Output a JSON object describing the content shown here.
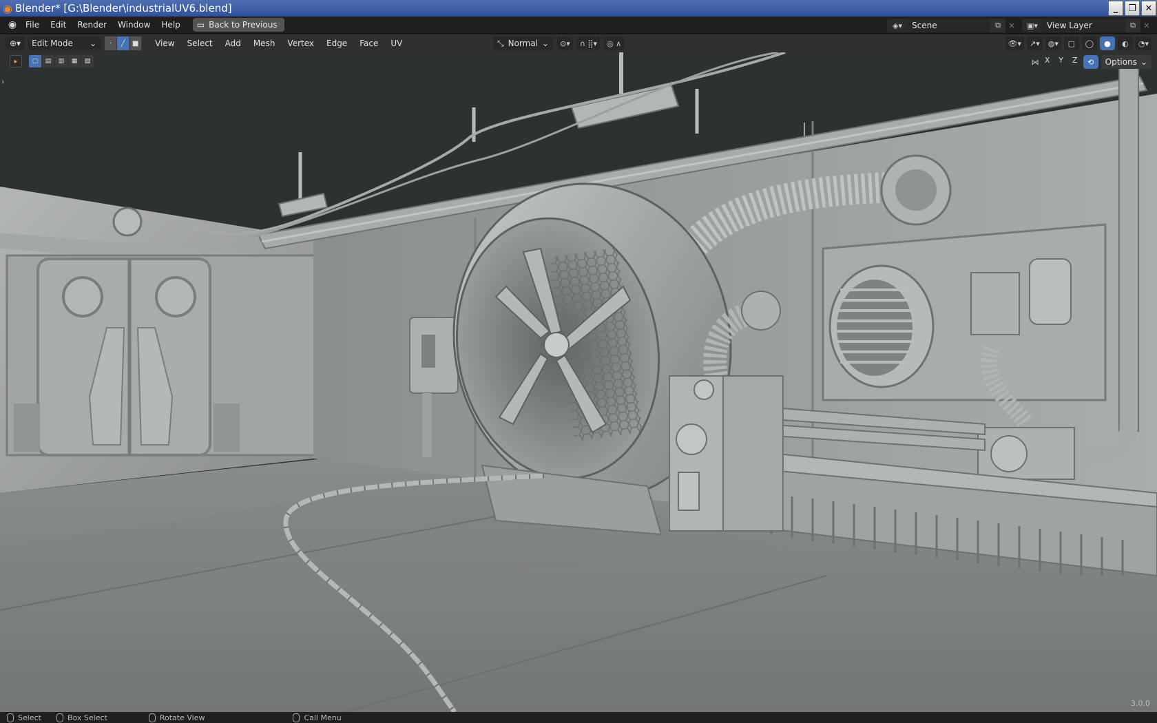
{
  "window": {
    "title": "Blender* [G:\\Blender\\industrialUV6.blend]",
    "controls": [
      "_",
      "❐",
      "✕"
    ]
  },
  "menubar": {
    "items": [
      "File",
      "Edit",
      "Render",
      "Window",
      "Help"
    ],
    "back_button": "Back to Previous",
    "scene_label": "Scene",
    "view_layer_label": "View Layer"
  },
  "header": {
    "mode": "Edit Mode",
    "menus": [
      "View",
      "Select",
      "Add",
      "Mesh",
      "Vertex",
      "Edge",
      "Face",
      "UV"
    ],
    "orientation": "Normal"
  },
  "viewport": {
    "axes": [
      "X",
      "Y",
      "Z"
    ],
    "options_label": "Options",
    "version": "3.0.0"
  },
  "statusbar": {
    "items": [
      "Select",
      "Box Select",
      "Rotate View",
      "Call Menu"
    ]
  }
}
